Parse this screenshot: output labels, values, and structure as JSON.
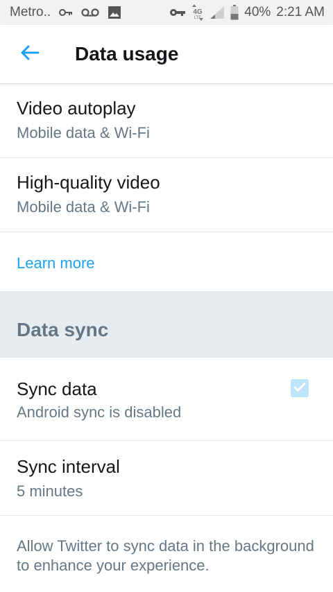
{
  "status_bar": {
    "carrier": "Metro..",
    "battery": "40%",
    "time": "2:21 AM",
    "network": "4G LTE",
    "icons": [
      "key-icon",
      "voicemail-icon",
      "image-icon",
      "vpn-key-icon",
      "network-4g-icon",
      "signal-icon",
      "battery-icon"
    ]
  },
  "app_bar": {
    "title": "Data usage",
    "back_icon": "arrow-left-icon",
    "accent": "#1da1f2"
  },
  "settings": {
    "video_autoplay": {
      "title": "Video autoplay",
      "value": "Mobile data & Wi-Fi"
    },
    "hq_video": {
      "title": "High-quality video",
      "value": "Mobile data & Wi-Fi"
    },
    "learn_more": "Learn more"
  },
  "data_sync": {
    "section_title": "Data sync",
    "sync_data": {
      "title": "Sync data",
      "value": "Android sync is disabled",
      "checked": true
    },
    "sync_interval": {
      "title": "Sync interval",
      "value": "5 minutes"
    },
    "note": "Allow Twitter to sync data in the background to enhance your experience."
  },
  "colors": {
    "section_bg": "#e6ecf0",
    "secondary_text": "#657786",
    "primary_text": "#14171a",
    "checkbox_disabled": "#bfe3fb"
  }
}
